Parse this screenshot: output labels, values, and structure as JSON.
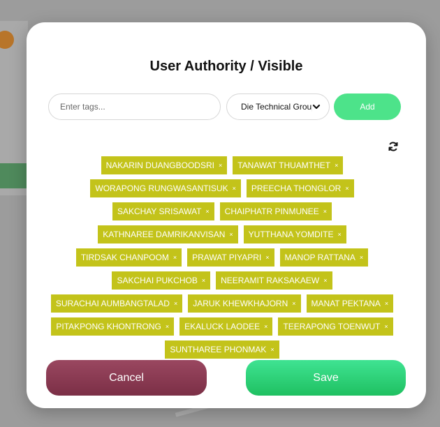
{
  "modal": {
    "title": "User Authority / Visible",
    "tag_input_placeholder": "Enter tags...",
    "group_select_value": "Die Technical Group",
    "add_label": "Add",
    "cancel_label": "Cancel",
    "save_label": "Save"
  },
  "tags": [
    "NAKARIN DUANGBOODSRI",
    "TANAWAT THUAMTHET",
    "WORAPONG RUNGWASANTISUK",
    "PREECHA THONGLOR",
    "SAKCHAY SRISAWAT",
    "CHAIPHATR PINMUNEE",
    "KATHNAREE DAMRIKANVISAN",
    "YUTTHANA YOMDITE",
    "TIRDSAK CHANPOOM",
    "PRAWAT PIYAPRI",
    "MANOP RATTANA",
    "SAKCHAI PUKCHOB",
    "NEERAMIT RAKSAKAEW",
    "SURACHAI AUMBANGTALAD",
    "JARUK KHEWKHAJORN",
    "MANAT PEKTANA",
    "PITAKPONG KHONTRONG",
    "EKALUCK LAODEE",
    "TEERAPONG TOENWUT",
    "SUNTHAREE PHONMAK"
  ],
  "colors": {
    "tag": "#c3c31a",
    "add": "#4de38a",
    "cancel": "#8b3b54",
    "save": "#2dd177"
  },
  "icons": {
    "refresh": "refresh-icon",
    "chevron": "chevron-down-icon",
    "remove": "close-icon"
  }
}
